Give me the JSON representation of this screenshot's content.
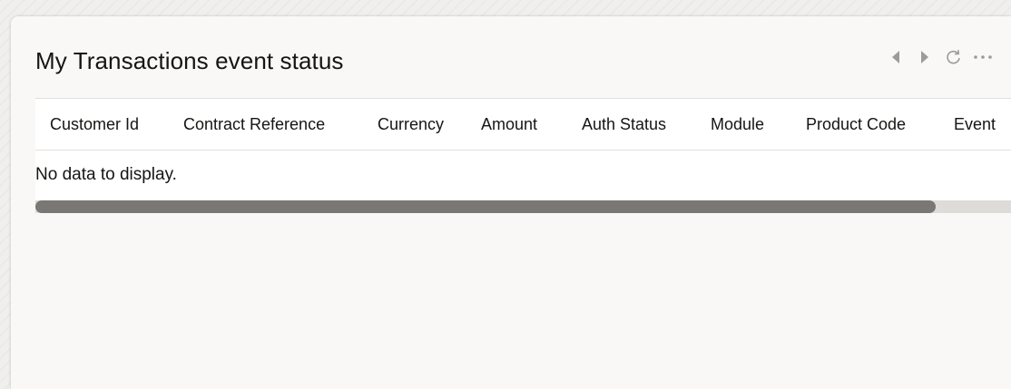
{
  "widget": {
    "title": "My Transactions event status",
    "actions": {
      "previous_icon": "caret-left-icon",
      "next_icon": "caret-right-icon",
      "refresh_icon": "refresh-icon",
      "more_icon": "more-horizontal-icon"
    }
  },
  "table": {
    "columns": [
      "Customer Id",
      "Contract Reference",
      "Currency",
      "Amount",
      "Auth Status",
      "Module",
      "Product Code",
      "Event"
    ],
    "empty_message": "No data to display."
  },
  "colors": {
    "text": "#161513",
    "icon_gray": "#9d9b98",
    "scroll_thumb": "#7a7875",
    "scroll_track": "#dedcd9"
  }
}
